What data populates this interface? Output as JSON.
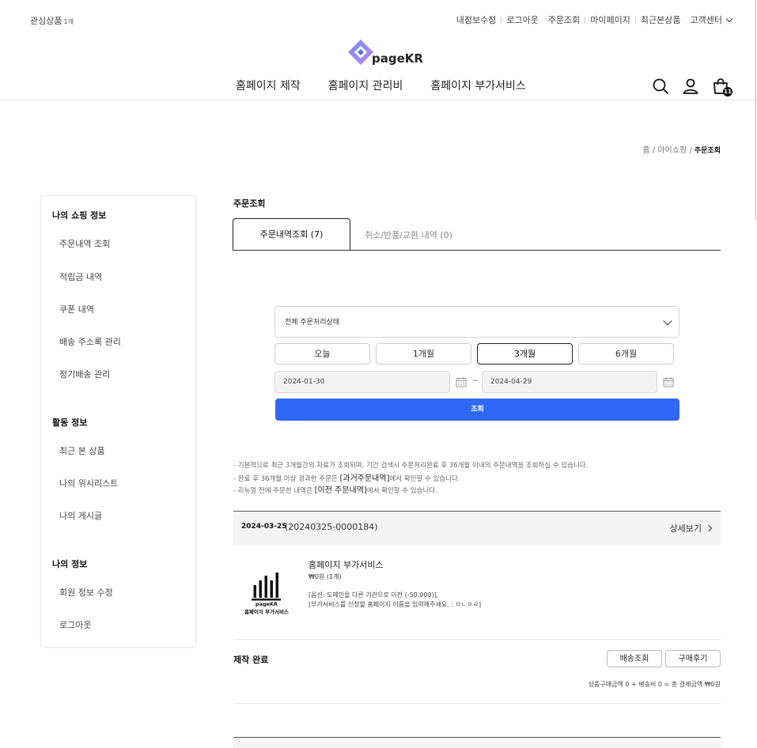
{
  "top_bar": {
    "wishlist_label": "관심상품",
    "wishlist_count": "1개",
    "links": [
      "내정보수정",
      "로그아웃",
      "주문조회",
      "마이페이지",
      "최근본상품",
      "고객센터"
    ]
  },
  "logo": {
    "text": "pageKR"
  },
  "gnb": {
    "items": [
      "홈페이지 제작",
      "홈페이지 관리비",
      "홈페이지 부가서비스"
    ],
    "cart_count": "11"
  },
  "breadcrumb": {
    "home": "홈",
    "mid": "마이쇼핑",
    "current": "주문조회",
    "separator": "/"
  },
  "sidebar": {
    "sections": [
      {
        "title": "나의 쇼핑 정보",
        "items": [
          "주문내역 조회",
          "적립금 내역",
          "쿠폰 내역",
          "배송 주소록 관리",
          "정기배송 관리"
        ]
      },
      {
        "title": "활동 정보",
        "items": [
          "최근 본 상품",
          "나의 위시리스트",
          "나의 게시글"
        ]
      },
      {
        "title": "나의 정보",
        "items": [
          "회원 정보 수정",
          "로그아웃"
        ]
      }
    ]
  },
  "main": {
    "title": "주문조회",
    "tabs": [
      {
        "label": "주문내역조회 (7)",
        "active": true
      },
      {
        "label": "취소/반품/교환 내역 (0)",
        "active": false
      }
    ],
    "status_select": "전체 주문처리상태",
    "periods": [
      {
        "label": "오늘",
        "active": false
      },
      {
        "label": "1개월",
        "active": false
      },
      {
        "label": "3개월",
        "active": true
      },
      {
        "label": "6개월",
        "active": false
      }
    ],
    "date_from": "2024-01-30",
    "date_to": "2024-04-29",
    "date_sep": "~",
    "search_button": "조회",
    "notices": [
      {
        "pre": "- 기본적으로 최근 3개월간의 자료가 조회되며, 기간 검색시 주문처리완료 후 36개월 이내의 주문내역을 조회하실 수 있습니다.",
        "link": "",
        "post": ""
      },
      {
        "pre": "- 완료 후 36개월 이상 경과한 주문은 ",
        "link": "[과거주문내역]",
        "post": "에서 확인할 수 있습니다."
      },
      {
        "pre": "- 리뉴얼 전에 주문한 내역은 ",
        "link": "[이전 주문내역]",
        "post": "에서 확인할 수 있습니다."
      }
    ]
  },
  "order": {
    "date": "2024-03-25",
    "number": "(20240325-0000184)",
    "detail_label": "상세보기",
    "product": {
      "thumb_caption_1": "pageKR",
      "thumb_caption_2": "홈페이지 부가서비스",
      "name": "홈페이지 부가서비스",
      "price": "₩0원 (1개)",
      "options": [
        "[옵션: 도메인을 다른 기관으로 이전 (-50,000)],",
        "[부가서비스를 신청할 홈페이지 이름을 입력해주세요. : ㅁㄴㅇㄹ]"
      ]
    },
    "status": "제작 완료",
    "buttons": [
      "배송조회",
      "구매후기"
    ],
    "summary": "상품구매금액 0 + 배송비 0 =  총 결제금액 ₩0원"
  }
}
